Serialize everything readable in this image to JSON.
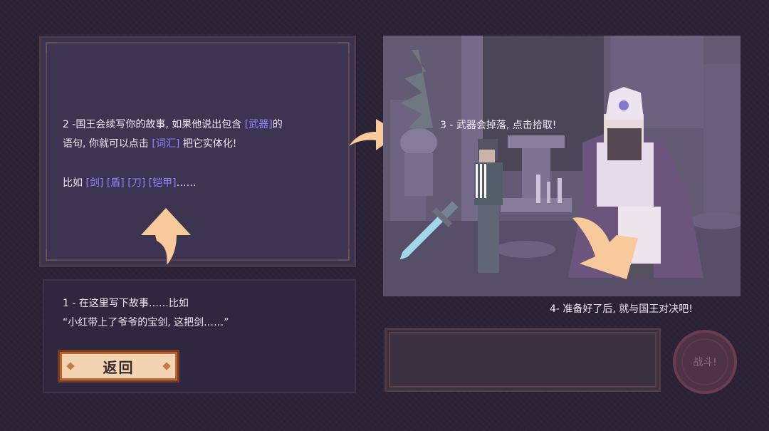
{
  "tutorial": {
    "step2": {
      "line1_prefix": "2 -国王会续写你的故事, 如果他说出包含 ",
      "line1_keyword": "[武器]",
      "line1_suffix": "的",
      "line2_prefix": "语句, 你就可以点击 ",
      "line2_keyword": "[词汇]",
      "line2_suffix": " 把它实体化!"
    },
    "examples": {
      "prefix": "比如 ",
      "items": [
        "[剑]",
        "[盾]",
        "[刀]",
        "[铠甲]"
      ],
      "suffix": "……"
    },
    "step1": {
      "line1": "1 - 在这里写下故事……比如",
      "line2": "“小红带上了爷爷的宝剑, 这把剑……”"
    },
    "step3": "3 - 武器会掉落, 点击拾取!",
    "step4": "4- 准备好了后, 就与国王对决吧!"
  },
  "buttons": {
    "back": "返回",
    "fight": "战斗!"
  },
  "colors": {
    "keyword": "#8f86ff",
    "arrow": "#f8c99a",
    "button_fill": "#f2d3b2"
  }
}
